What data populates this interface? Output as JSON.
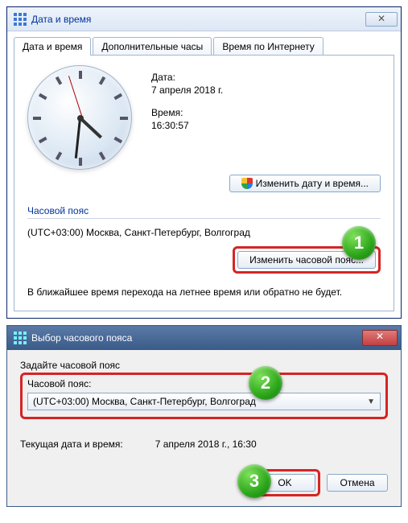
{
  "window1": {
    "title": "Дата и время",
    "tabs": [
      "Дата и время",
      "Дополнительные часы",
      "Время по Интернету"
    ],
    "date_label": "Дата:",
    "date_value": "7 апреля 2018 г.",
    "time_label": "Время:",
    "time_value": "16:30:57",
    "change_datetime_btn": "Изменить дату и время...",
    "tz_section": "Часовой пояс",
    "tz_value": "(UTC+03:00) Москва, Санкт-Петербург, Волгоград",
    "change_tz_btn": "Изменить часовой пояс...",
    "dst_note": "В ближайшее время перехода на летнее время или обратно не будет."
  },
  "window2": {
    "title": "Выбор часового пояса",
    "instruction": "Задайте часовой пояс",
    "tz_label": "Часовой пояс:",
    "tz_selected": "(UTC+03:00) Москва, Санкт-Петербург, Волгоград",
    "current_dt_label": "Текущая дата и время:",
    "current_dt_value": "7 апреля 2018 г., 16:30",
    "ok_btn": "OK",
    "cancel_btn": "Отмена"
  },
  "badges": {
    "b1": "1",
    "b2": "2",
    "b3": "3"
  }
}
